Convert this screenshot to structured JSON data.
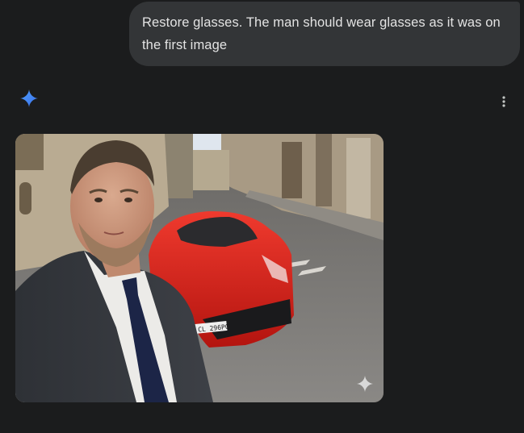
{
  "conversation": {
    "user_message": "Restore glasses. The man should wear glasses as it was on the first image"
  },
  "response": {
    "avatar_icon": "gemini-sparkle-icon",
    "more_icon": "more-vert-icon",
    "image": {
      "content": "generated-photo",
      "license_plate": "CL 296PC",
      "watermark_icon": "sparkle-watermark-icon"
    }
  },
  "colors": {
    "background": "#1b1c1d",
    "bubble": "#333537",
    "text": "#e3e3e3",
    "accent": "#4285f4",
    "car": "#d8201c"
  }
}
